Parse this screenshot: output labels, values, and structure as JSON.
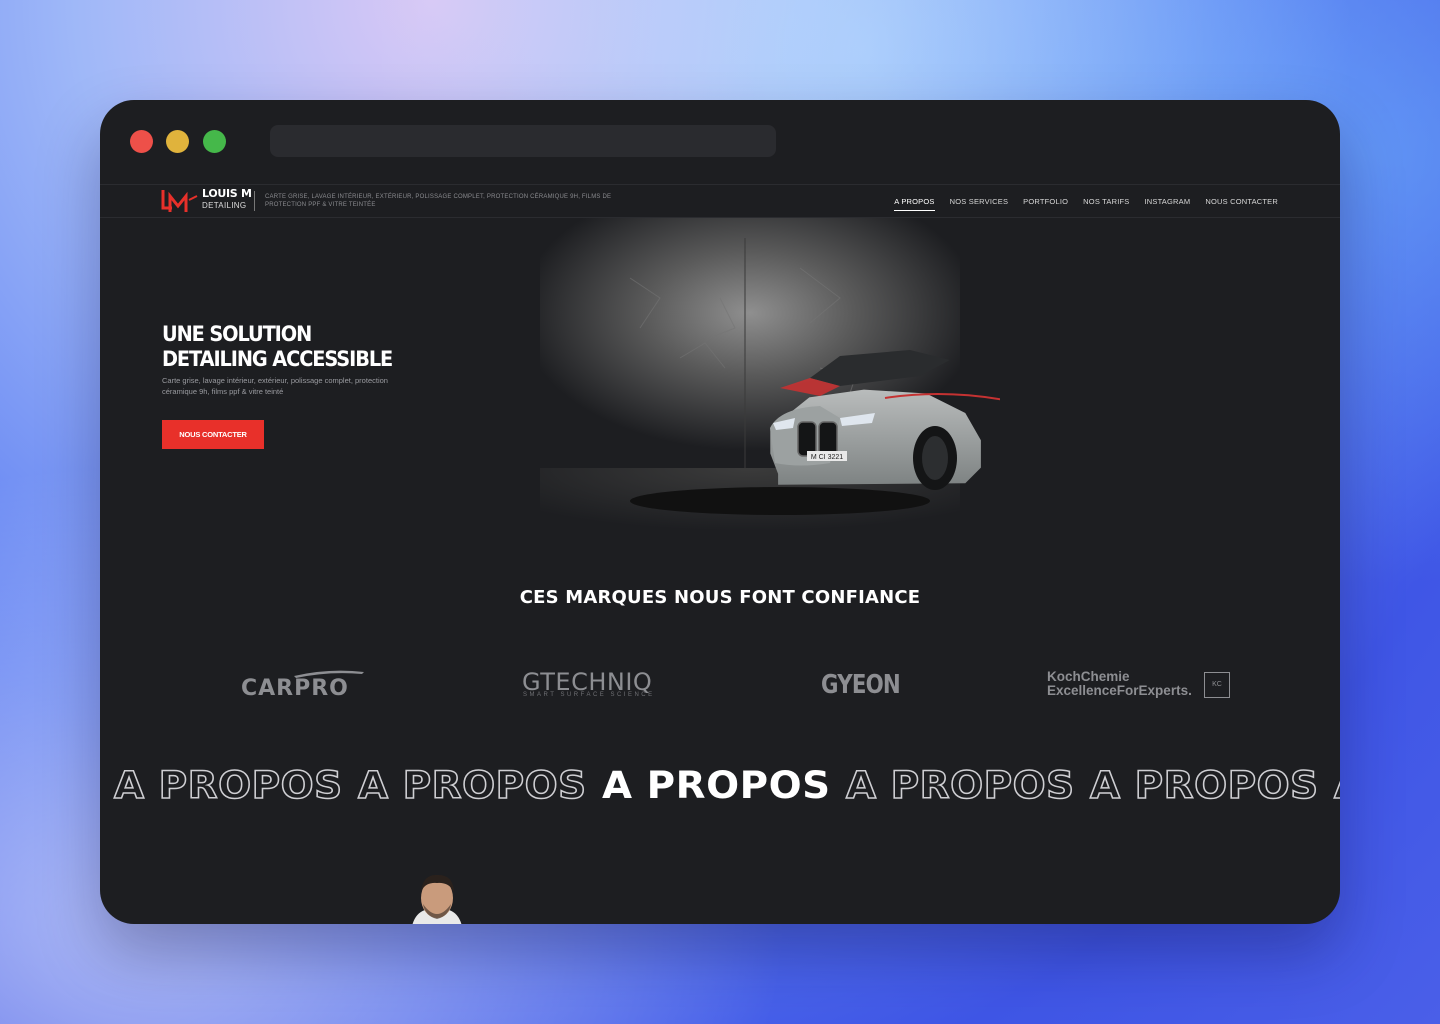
{
  "site": {
    "brand_name": "LOUIS M",
    "brand_sub": "DETAILING",
    "tagline": "CARTE GRISE, LAVAGE INTÉRIEUR, EXTÉRIEUR, POLISSAGE COMPLET, PROTECTION CÉRAMIQUE 9H, FILMS DE PROTECTION PPF & VITRE TEINTÉE"
  },
  "nav": {
    "items": [
      "A PROPOS",
      "NOS SERVICES",
      "PORTFOLIO",
      "NOS TARIFS",
      "INSTAGRAM",
      "NOUS CONTACTER"
    ],
    "active_index": 0
  },
  "hero": {
    "title": "UNE SOLUTION DETAILING ACCESSIBLE",
    "description": "Carte grise, lavage intérieur, extérieur, polissage complet, protection céramique 9h, films ppf & vitre teinté",
    "cta_label": "NOUS CONTACTER",
    "plate": "M CI 3221"
  },
  "brands": {
    "title": "CES MARQUES NOUS FONT CONFIANCE",
    "logos": [
      {
        "name": "CARPRO"
      },
      {
        "name": "GTECHNIQ",
        "sub": "SMART SURFACE SCIENCE"
      },
      {
        "name": "GYEON"
      },
      {
        "name": "KochChemie",
        "sub": "ExcellenceForExperts.",
        "badge": "KC"
      }
    ]
  },
  "marquee": {
    "text": "A PROPOS",
    "highlight_index": 2
  },
  "colors": {
    "accent": "#e8302a",
    "page_bg": "#1d1e21",
    "text_muted": "#9a9ba0"
  }
}
